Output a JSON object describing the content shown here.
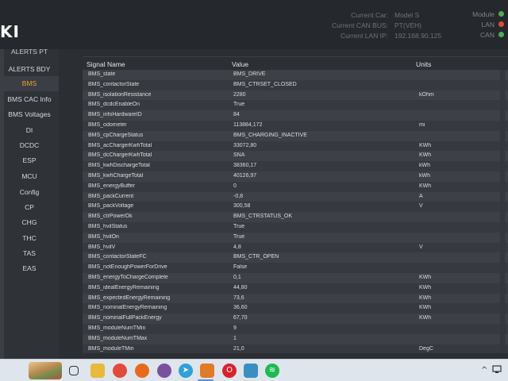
{
  "header": {
    "logo": "KI",
    "current_car_label": "Current Car:",
    "current_car_value": "Model S",
    "can_bus_label": "Current CAN BUS:",
    "can_bus_value": "PT(VEH)",
    "lan_ip_label": "Current LAN IP:",
    "lan_ip_value": "192.168.90.125",
    "status": [
      {
        "label": "Module",
        "color": "#4caf50"
      },
      {
        "label": "LAN",
        "color": "#e04a3a"
      },
      {
        "label": "CAN",
        "color": "#4caf50"
      }
    ]
  },
  "sidebar": {
    "items": [
      {
        "label": "ALERTS PT"
      },
      {
        "label": "ALERTS BDY"
      },
      {
        "label": "BMS"
      },
      {
        "label": "BMS CAC Info"
      },
      {
        "label": "BMS Voltages"
      },
      {
        "label": "DI"
      },
      {
        "label": "DCDC"
      },
      {
        "label": "ESP"
      },
      {
        "label": "MCU"
      },
      {
        "label": "Config"
      },
      {
        "label": "CP"
      },
      {
        "label": "CHG"
      },
      {
        "label": "THC"
      },
      {
        "label": "TAS"
      },
      {
        "label": "EAS"
      }
    ],
    "active_label": "BMS"
  },
  "table": {
    "headers": {
      "name": "Signal Name",
      "value": "Value",
      "units": "Units"
    },
    "rows": [
      {
        "name": "BMS_state",
        "value": "BMS_DRIVE",
        "units": ""
      },
      {
        "name": "BMS_contactorState",
        "value": "BMS_CTRSET_CLOSED",
        "units": ""
      },
      {
        "name": "BMS_isolationResistance",
        "value": "2280",
        "units": "kOhm"
      },
      {
        "name": "BMS_dcdcEnableOn",
        "value": "True",
        "units": ""
      },
      {
        "name": "BMS_infoHardwareID",
        "value": "84",
        "units": ""
      },
      {
        "name": "BMS_odometer",
        "value": "113884,172",
        "units": "mi"
      },
      {
        "name": "BMS_cpChargeStatus",
        "value": "BMS_CHARGING_INACTIVE",
        "units": ""
      },
      {
        "name": "BMS_acChargerKwhTotal",
        "value": "33072,80",
        "units": "KWh"
      },
      {
        "name": "BMS_dcChargerKwhTotal",
        "value": "SNA",
        "units": "KWh"
      },
      {
        "name": "BMS_kwhDischargeTotal",
        "value": "38360,17",
        "units": "kWh"
      },
      {
        "name": "BMS_kwhChargeTotal",
        "value": "40126,97",
        "units": "kWh"
      },
      {
        "name": "BMS_energyBuffer",
        "value": "0",
        "units": "KWh"
      },
      {
        "name": "BMS_packCurrent",
        "value": "-0,8",
        "units": "A"
      },
      {
        "name": "BMS_packVoltage",
        "value": "300,58",
        "units": "V"
      },
      {
        "name": "BMS_ctrPowerOk",
        "value": "BMS_CTRSTATUS_OK",
        "units": ""
      },
      {
        "name": "BMS_hvilStatus",
        "value": "True",
        "units": ""
      },
      {
        "name": "BMS_hvilOn",
        "value": "True",
        "units": ""
      },
      {
        "name": "BMS_hvilV",
        "value": "4,8",
        "units": "V"
      },
      {
        "name": "BMS_contactorStateFC",
        "value": "BMS_CTR_OPEN",
        "units": ""
      },
      {
        "name": "BMS_notEnoughPowerForDrive",
        "value": "False",
        "units": ""
      },
      {
        "name": "BMS_energyToChargeComplete",
        "value": "0,1",
        "units": "KWh"
      },
      {
        "name": "BMS_idealEnergyRemaining",
        "value": "44,80",
        "units": "KWh"
      },
      {
        "name": "BMS_expectedEnergyRemaining",
        "value": "73,6",
        "units": "KWh"
      },
      {
        "name": "BMS_nominalEnergyRemaining",
        "value": "36,60",
        "units": "KWh"
      },
      {
        "name": "BMS_nominalFullPackEnergy",
        "value": "67,70",
        "units": "KWh"
      },
      {
        "name": "BMS_moduleNumTMin",
        "value": "9",
        "units": ""
      },
      {
        "name": "BMS_moduleNumTMax",
        "value": "1",
        "units": ""
      },
      {
        "name": "BMS_moduleTMin",
        "value": "21,0",
        "units": "DegC"
      }
    ]
  },
  "taskbar": {
    "icons": [
      {
        "name": "desktop-thumbnail-icon",
        "color": "#c89a5a"
      },
      {
        "name": "task-view-icon",
        "color": "#dfe5ec"
      },
      {
        "name": "file-explorer-icon",
        "color": "#e8b93a"
      },
      {
        "name": "chrome-icon",
        "color": "#e24a3b"
      },
      {
        "name": "firefox-icon",
        "color": "#e66b1f"
      },
      {
        "name": "viber-icon",
        "color": "#7b519d"
      },
      {
        "name": "telegram-icon",
        "color": "#2fa0da"
      },
      {
        "name": "app-fox-icon",
        "color": "#e07b2a"
      },
      {
        "name": "opera-icon",
        "color": "#d8222d"
      },
      {
        "name": "notepad-icon",
        "color": "#3a8fc2"
      },
      {
        "name": "spotify-icon",
        "color": "#1db954"
      }
    ],
    "tray_chevron": "^"
  }
}
